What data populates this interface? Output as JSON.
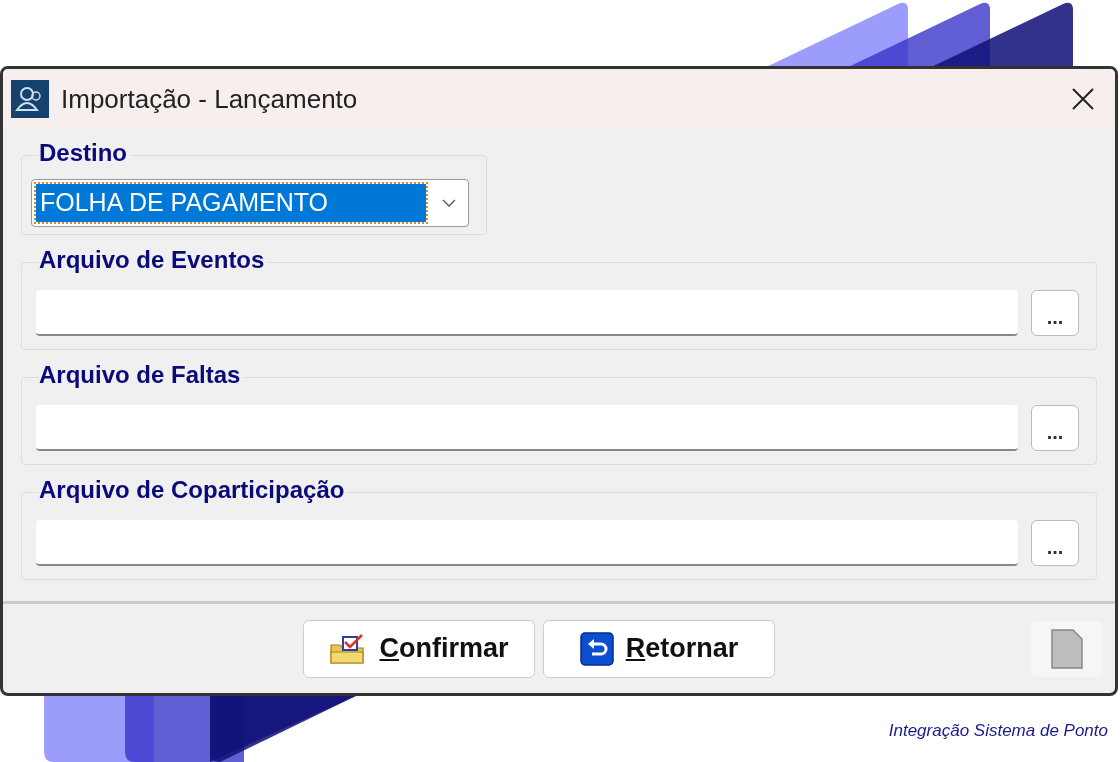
{
  "window": {
    "title": "Importação - Lançamento"
  },
  "destination": {
    "label": "Destino",
    "value": "FOLHA DE PAGAMENTO",
    "focused": true
  },
  "file_fields": [
    {
      "label": "Arquivo de Eventos",
      "button": "..."
    },
    {
      "label": "Arquivo de Faltas",
      "button": "..."
    },
    {
      "label": "Arquivo de Coparticipação",
      "button": "..."
    }
  ],
  "buttons": [
    {
      "label": "Confirmar",
      "kind": "confirm"
    },
    {
      "label": "Retornar",
      "kind": "return"
    }
  ],
  "extra_button": {
    "disabled": true
  },
  "caption": "Integração Sistema de Ponto"
}
